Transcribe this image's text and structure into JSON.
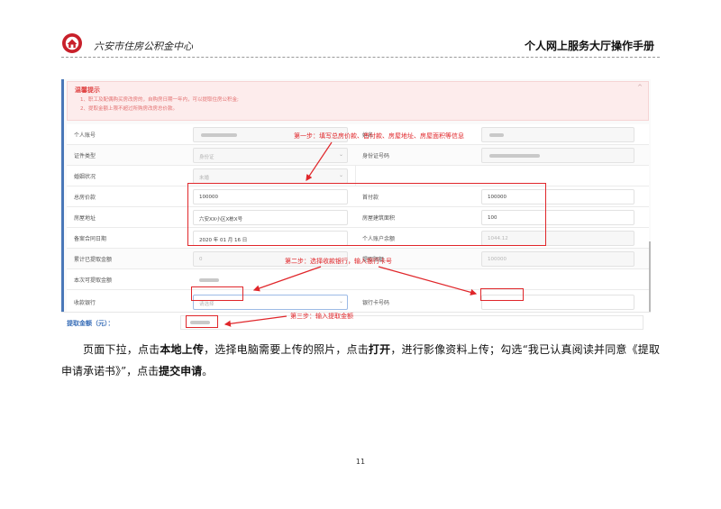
{
  "header": {
    "org_name": "六安市住房公积金中心",
    "manual_title": "个人网上服务大厅操作手册"
  },
  "tips": {
    "title": "温馨提示",
    "line1": "1、职工及配偶购买房改房的，自购房日期一年内，可以提取住房公积金;",
    "line2": "2、提取金额上限不超过所购房改房总价款。",
    "close": "^"
  },
  "form": {
    "rows": [
      {
        "left_label": "个人账号",
        "right_label": "姓名"
      },
      {
        "left_label": "证件类型",
        "left_value": "身份证",
        "right_label": "身份证号码"
      },
      {
        "left_label": "婚姻状况",
        "left_value": "未婚"
      },
      {
        "left_label": "总房价款",
        "left_value": "100000",
        "right_label": "首付款",
        "right_value": "100000"
      },
      {
        "left_label": "房屋地址",
        "left_value": "六安XX小区X栋X号",
        "right_label": "房屋建筑面积",
        "right_value": "100"
      },
      {
        "left_label": "备案合同日期",
        "left_value": "2020 年 01 月 16 日",
        "right_label": "个人账户余额",
        "right_value": "1044.12"
      },
      {
        "left_label": "累计已提取金额",
        "left_value": "0",
        "right_label": "提取限额",
        "right_value": "100000"
      },
      {
        "left_label": "本次可提取金额"
      },
      {
        "left_label": "收款银行",
        "left_value": "请选择",
        "right_label": "银行卡号码"
      }
    ],
    "amount_label": "提取金额（元）："
  },
  "steps": {
    "step1": "第一步：填写总房价款、首付款、房屋地址、房屋面积等信息",
    "step2": "第二步：选择收款银行，输入银行卡号",
    "step3": "第三步：输入提取金额"
  },
  "body": {
    "t1": "页面下拉，点击",
    "t2": "本地上传",
    "t3": "，选择电脑需要上传的照片，点击",
    "t4": "打开",
    "t5": "，进行影像资料上传；勾选“我已认真阅读并同意《提取申请承诺书》”，点击",
    "t6": "提交申请",
    "t7": "。"
  },
  "page_number": "11",
  "colors": {
    "annotation": "#e0262a",
    "accent": "#3a6fb8",
    "logo": "#c8202a"
  }
}
